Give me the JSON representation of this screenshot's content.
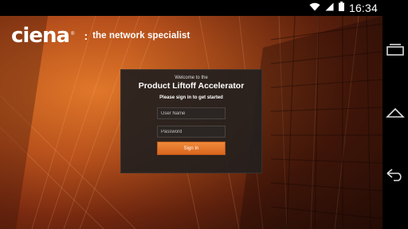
{
  "status_bar": {
    "time": "16:34",
    "icons": [
      "wifi-icon",
      "signal-icon",
      "battery-icon"
    ]
  },
  "brand": {
    "logo_text": "ciena",
    "registered_mark": "®",
    "separator": ":",
    "tagline": "the network specialist"
  },
  "login": {
    "welcome": "Welcome to the",
    "title": "Product Liftoff Accelerator",
    "subtitle": "Please sign in to get started",
    "username_placeholder": "User Name",
    "password_placeholder": "Password",
    "signin_label": "Sign In"
  },
  "nav_bar": {
    "buttons": [
      "recents-icon",
      "home-icon",
      "back-icon"
    ]
  },
  "colors": {
    "accent": "#e8782c",
    "card_bg": "#231f1e",
    "background": "#b8511c"
  }
}
